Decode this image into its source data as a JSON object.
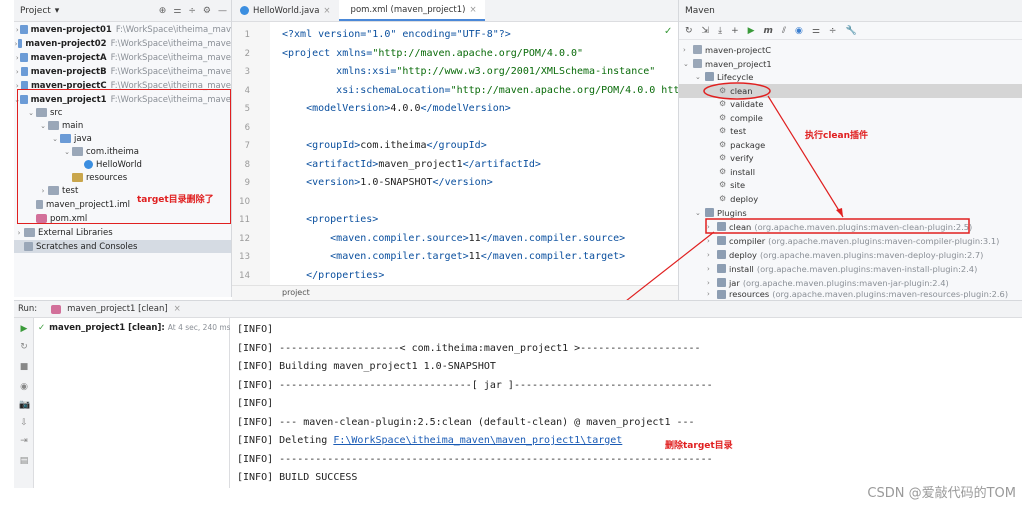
{
  "project": {
    "header_label": "Project",
    "header_arrow": "▾",
    "tools": [
      "⊕",
      "⚌",
      "÷",
      "⚙",
      "—"
    ],
    "items": [
      {
        "label": "maven-project01",
        "path": "F:\\WorkSpace\\itheima_mav"
      },
      {
        "label": "maven-project02",
        "path": "F:\\WorkSpace\\itheima_mave"
      },
      {
        "label": "maven-projectA",
        "path": "F:\\WorkSpace\\itheima_mave"
      },
      {
        "label": "maven-projectB",
        "path": "F:\\WorkSpace\\itheima_mave"
      },
      {
        "label": "maven-projectC",
        "path": "F:\\WorkSpace\\itheima_mave"
      },
      {
        "label": "maven_project1",
        "path": "F:\\WorkSpace\\itheima_mave"
      },
      {
        "label": "src"
      },
      {
        "label": "main"
      },
      {
        "label": "java"
      },
      {
        "label": "com.itheima"
      },
      {
        "label": "HelloWorld"
      },
      {
        "label": "resources"
      },
      {
        "label": "test"
      },
      {
        "label": "maven_project1.iml"
      },
      {
        "label": "pom.xml"
      },
      {
        "label": "External Libraries"
      },
      {
        "label": "Scratches and Consoles"
      }
    ],
    "annotation": "target目录删除了"
  },
  "editor": {
    "tabs": [
      {
        "label": "HelloWorld.java",
        "close": "×"
      },
      {
        "label": "pom.xml (maven_project1)",
        "close": "×"
      }
    ],
    "check": "✓",
    "line_numbers": [
      "1",
      "2",
      "3",
      "4",
      "5",
      "6",
      "7",
      "8",
      "9",
      "10",
      "11",
      "12",
      "13",
      "14"
    ],
    "lines": [
      {
        "parts": [
          {
            "t": "<?xml version=\"1.0\" encoding=\"UTF-8\"?>",
            "c": "tag"
          }
        ]
      },
      {
        "parts": [
          {
            "t": "<project ",
            "c": "tag"
          },
          {
            "t": "xmlns=",
            "c": "atr"
          },
          {
            "t": "\"http://maven.apache.org/POM/4.0.0\"",
            "c": "val"
          }
        ]
      },
      {
        "parts": [
          {
            "t": "         xmlns:xsi=",
            "c": "atr"
          },
          {
            "t": "\"http://www.w3.org/2001/XMLSchema-instance\"",
            "c": "val"
          }
        ]
      },
      {
        "parts": [
          {
            "t": "         xsi:schemaLocation=",
            "c": "atr"
          },
          {
            "t": "\"http://maven.apache.org/POM/4.0.0 http",
            "c": "val"
          }
        ]
      },
      {
        "parts": [
          {
            "t": "    <modelVersion>",
            "c": "tag"
          },
          {
            "t": "4.0.0",
            "c": ""
          },
          {
            "t": "</modelVersion>",
            "c": "tag"
          }
        ]
      },
      {
        "parts": []
      },
      {
        "parts": [
          {
            "t": "    <groupId>",
            "c": "tag"
          },
          {
            "t": "com.itheima",
            "c": ""
          },
          {
            "t": "</groupId>",
            "c": "tag"
          }
        ]
      },
      {
        "parts": [
          {
            "t": "    <artifactId>",
            "c": "tag"
          },
          {
            "t": "maven_project1",
            "c": ""
          },
          {
            "t": "</artifactId>",
            "c": "tag"
          }
        ]
      },
      {
        "parts": [
          {
            "t": "    <version>",
            "c": "tag"
          },
          {
            "t": "1.0-SNAPSHOT",
            "c": ""
          },
          {
            "t": "</version>",
            "c": "tag"
          }
        ]
      },
      {
        "parts": []
      },
      {
        "parts": [
          {
            "t": "    <properties>",
            "c": "tag"
          }
        ]
      },
      {
        "parts": [
          {
            "t": "        <maven.compiler.source>",
            "c": "tag"
          },
          {
            "t": "11",
            "c": ""
          },
          {
            "t": "</maven.compiler.source>",
            "c": "tag"
          }
        ]
      },
      {
        "parts": [
          {
            "t": "        <maven.compiler.target>",
            "c": "tag"
          },
          {
            "t": "11",
            "c": ""
          },
          {
            "t": "</maven.compiler.target>",
            "c": "tag"
          }
        ]
      },
      {
        "parts": [
          {
            "t": "    </properties>",
            "c": "tag"
          }
        ]
      }
    ],
    "breadcrumb": "project"
  },
  "maven": {
    "title": "Maven",
    "toolbar": [
      "↻",
      "⇲",
      "⤓",
      "+",
      "▶",
      "m",
      "⫽",
      "◉",
      "⚌",
      "÷",
      "🔧"
    ],
    "rows": [
      {
        "label": "maven-projectC"
      },
      {
        "label": "maven_project1"
      },
      {
        "label": "Lifecycle"
      },
      {
        "label": "clean"
      },
      {
        "label": "validate"
      },
      {
        "label": "compile"
      },
      {
        "label": "test"
      },
      {
        "label": "package"
      },
      {
        "label": "verify"
      },
      {
        "label": "install"
      },
      {
        "label": "site"
      },
      {
        "label": "deploy"
      },
      {
        "label": "Plugins"
      },
      {
        "label": "clean",
        "detail": "(org.apache.maven.plugins:maven-clean-plugin:2.5)"
      },
      {
        "label": "compiler",
        "detail": "(org.apache.maven.plugins:maven-compiler-plugin:3.1)"
      },
      {
        "label": "deploy",
        "detail": "(org.apache.maven.plugins:maven-deploy-plugin:2.7)"
      },
      {
        "label": "install",
        "detail": "(org.apache.maven.plugins:maven-install-plugin:2.4)"
      },
      {
        "label": "jar",
        "detail": "(org.apache.maven.plugins:maven-jar-plugin:2.4)"
      },
      {
        "label": "resources",
        "detail": "(org.apache.maven.plugins:maven-resources-plugin:2.6)"
      }
    ],
    "annotation": "执行clean插件"
  },
  "run": {
    "label": "Run:",
    "tab": "maven_project1 [clean]",
    "tab_close": "×",
    "tree_label": "maven_project1 [clean]:",
    "tree_time": "At 4 sec, 240 ms",
    "side_icons": [
      "▶",
      "↻",
      "■",
      "◉",
      "📷",
      "⇩",
      "⇥",
      "▤"
    ],
    "console": [
      {
        "text": "[INFO]"
      },
      {
        "text": "[INFO] --------------------< com.itheima:maven_project1 >--------------------"
      },
      {
        "text": "[INFO] Building maven_project1 1.0-SNAPSHOT"
      },
      {
        "text": "[INFO] --------------------------------[ jar ]---------------------------------"
      },
      {
        "text": "[INFO]"
      },
      {
        "text": "[INFO] --- maven-clean-plugin:2.5:clean (default-clean) @ maven_project1 ---"
      },
      {
        "prefix": "[INFO] Deleting ",
        "link": "F:\\WorkSpace\\itheima_maven\\maven_project1\\target"
      },
      {
        "text": "[INFO] ------------------------------------------------------------------------"
      },
      {
        "text": "[INFO] BUILD SUCCESS"
      }
    ],
    "annotation": "删除target目录"
  },
  "watermark": "CSDN @爱敲代码的TOM",
  "colors": {
    "annotation_red": "#e02020",
    "link_blue": "#1a5bb5",
    "xml_tag": "#0a4f9e",
    "xml_value": "#0a6b0a"
  }
}
